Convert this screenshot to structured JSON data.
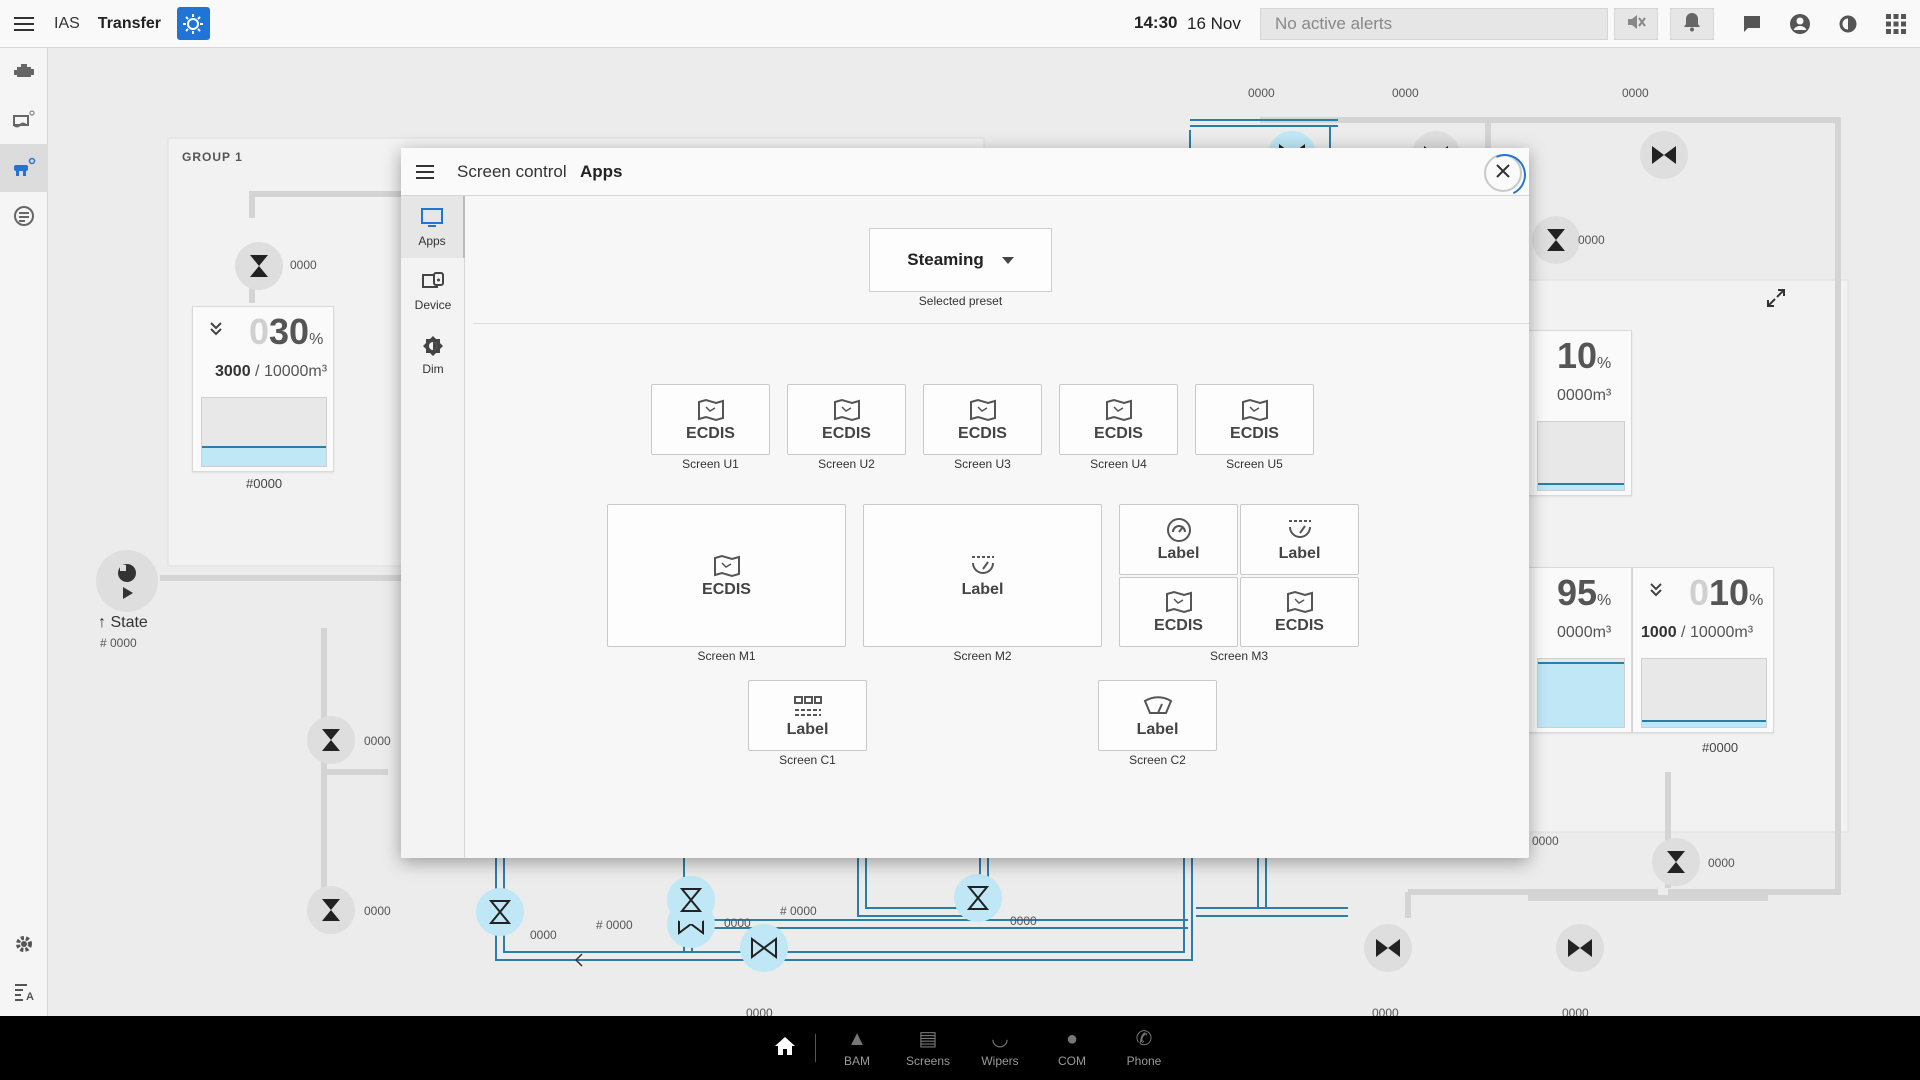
{
  "topbar": {
    "app_name": "IAS",
    "app_title": "Transfer",
    "time": "14:30",
    "date": "16 Nov",
    "alerts_text": "No active alerts"
  },
  "background": {
    "group_label": "GROUP 1",
    "tank_left": {
      "pct_dim": "0",
      "pct": "30",
      "unit": "%",
      "volume": "3000",
      "capacity": "10000m³",
      "id": "#0000",
      "fill": 0.3
    },
    "tank_right": {
      "pct_dim": "0",
      "pct": "10",
      "unit": "%",
      "volume": "1000",
      "capacity": "10000m³",
      "id": "#0000",
      "fill": 0.1
    },
    "partial_pct_a": "10",
    "partial_unit_a": "%",
    "partial_cap_a": "0000m³",
    "partial_pct_b": "95",
    "partial_unit_b": "%",
    "partial_cap_b": "0000m³",
    "pump_state": "↑ State",
    "pump_num": "#  0000",
    "readings": {
      "r1": "0000",
      "r2": "0000",
      "r3": "0000",
      "r4": "0000",
      "r5": "0000",
      "r6": "0000",
      "r7": "0000",
      "r8": "0000",
      "r9": "0000",
      "r10": "0000",
      "r11": "0000",
      "r12": "0000",
      "r13": "0000",
      "r14": "0000",
      "r15": "0000",
      "r16": "0000",
      "r17": "# 0000",
      "r18": "# 0000"
    }
  },
  "dialog": {
    "title_prefix": "Screen control",
    "title": "Apps",
    "side": [
      {
        "label": "Apps",
        "icon": "monitor-icon"
      },
      {
        "label": "Device",
        "icon": "device-icon"
      },
      {
        "label": "Dim",
        "icon": "dim-icon"
      }
    ],
    "preset": {
      "value": "Steaming",
      "label": "Selected preset"
    },
    "screens_u": [
      {
        "app": "ECDIS",
        "caption": "Screen U1"
      },
      {
        "app": "ECDIS",
        "caption": "Screen U2"
      },
      {
        "app": "ECDIS",
        "caption": "Screen U3"
      },
      {
        "app": "ECDIS",
        "caption": "Screen U4"
      },
      {
        "app": "ECDIS",
        "caption": "Screen U5"
      }
    ],
    "screen_m1": {
      "app": "ECDIS",
      "caption": "Screen M1"
    },
    "screen_m2": {
      "app": "Label",
      "caption": "Screen M2"
    },
    "screen_m3": {
      "caption": "Screen M3",
      "tiles": [
        {
          "app": "Label",
          "icon": "gauge-icon"
        },
        {
          "app": "Label",
          "icon": "conning-icon"
        },
        {
          "app": "ECDIS",
          "icon": "map-icon"
        },
        {
          "app": "ECDIS",
          "icon": "map-icon"
        }
      ]
    },
    "screen_c1": {
      "app": "Label",
      "caption": "Screen C1"
    },
    "screen_c2": {
      "app": "Label",
      "caption": "Screen C2"
    }
  },
  "bottombar": {
    "items": [
      {
        "label": "BAM",
        "icon": "bam-icon"
      },
      {
        "label": "Screens",
        "icon": "screens-icon"
      },
      {
        "label": "Wipers",
        "icon": "wipers-icon"
      },
      {
        "label": "COM",
        "icon": "mic-icon"
      },
      {
        "label": "Phone",
        "icon": "phone-icon"
      }
    ]
  },
  "colors": {
    "accent": "#1f74d6",
    "fluid": "#bfe7f5",
    "pipe_active": "#2b7ea8"
  }
}
